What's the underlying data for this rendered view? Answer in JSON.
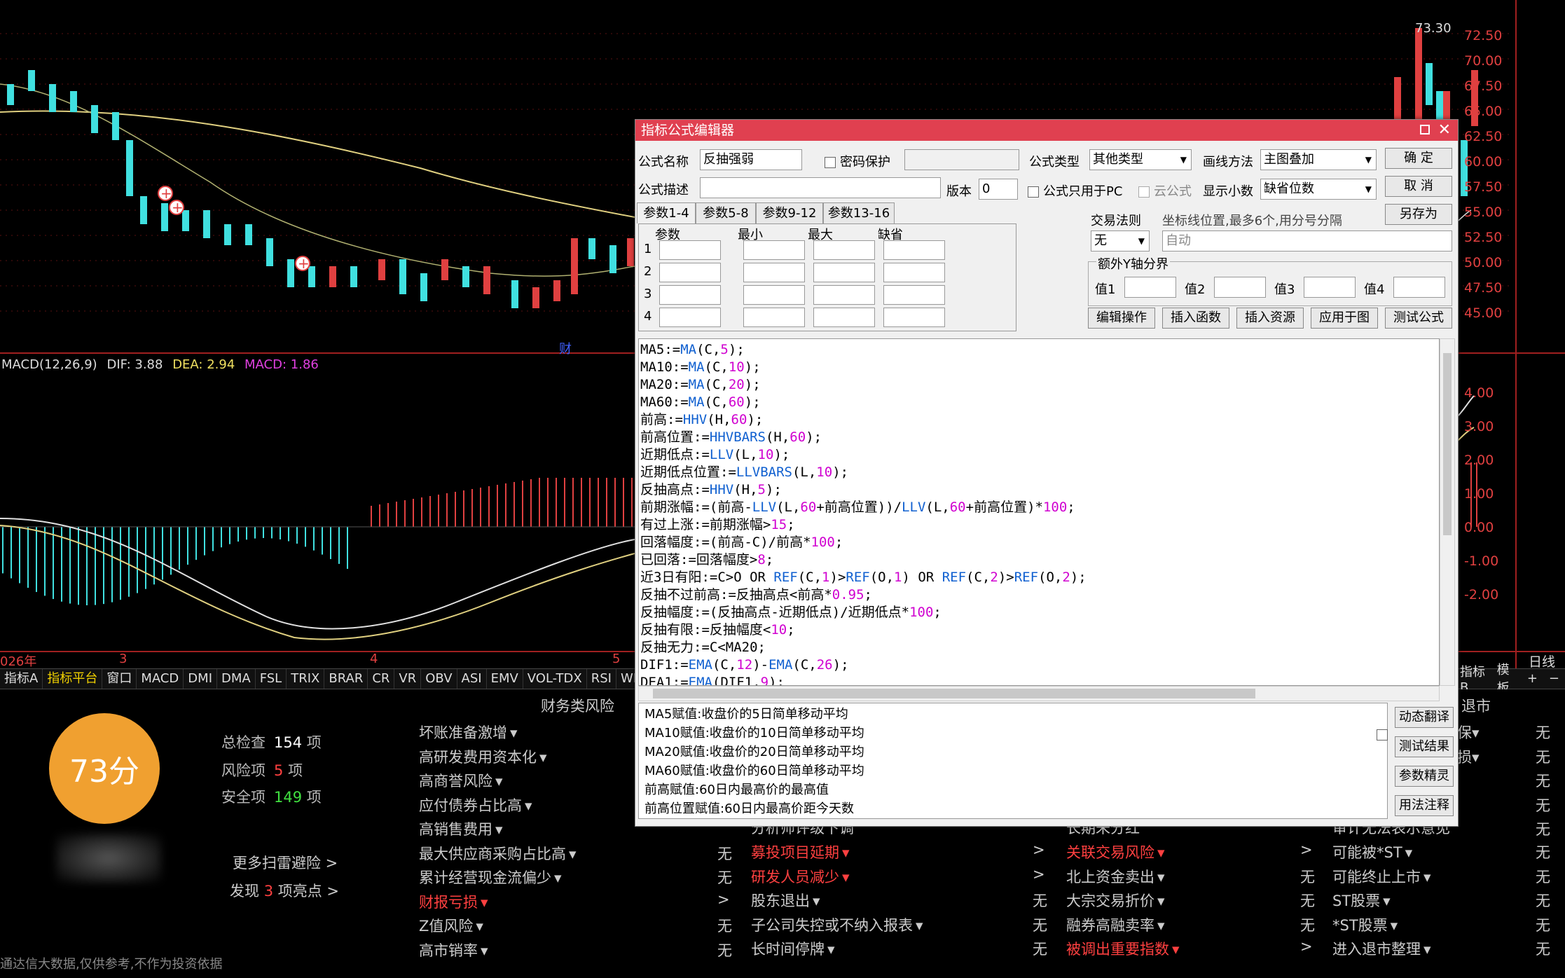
{
  "chart": {
    "price_labels": [
      "72.50",
      "70.00",
      "67.50",
      "65.00",
      "62.50",
      "60.00",
      "57.50",
      "55.00",
      "52.50",
      "50.00",
      "47.50",
      "45.00"
    ],
    "high_label": "73.30",
    "macd_header": "MACD(12,26,9)",
    "dif_text": "DIF: 3.88",
    "dea_text": "DEA: 2.94",
    "macd_text": "MACD: 1.86",
    "macd_labels": [
      "4.00",
      "3.00",
      "2.00",
      "1.00",
      "0.00",
      "-1.00",
      "-2.00"
    ],
    "date_labels": [
      "026年",
      "3",
      "4",
      "5"
    ],
    "fin_marker": "财",
    "period_label": "日线"
  },
  "tabbar": {
    "tabs": [
      "指标A",
      "指标平台",
      "窗口",
      "MACD",
      "DMI",
      "DMA",
      "FSL",
      "TRIX",
      "BRAR",
      "CR",
      "VR",
      "OBV",
      "ASI",
      "EMV",
      "VOL-TDX",
      "RSI",
      "WR"
    ],
    "right_tabs": [
      "指标B",
      "模板",
      "+",
      "−"
    ]
  },
  "risk": {
    "score": "73分",
    "total_label": "总检查",
    "total_value": "154",
    "risk_label": "风险项",
    "risk_value": "5",
    "safe_label": "安全项",
    "safe_value": "149",
    "unit": "项",
    "more_link": "更多扫雷避险 >",
    "found_prefix": "发现",
    "found_value": "3",
    "found_suffix": "项亮点 >",
    "disclaimer": "通达信大数据,仅供参考,不作为投资依据",
    "section_finance": "财务类风险",
    "section_delist": "退市",
    "col1": [
      {
        "label": "坏账准备激增",
        "red": false,
        "val": ""
      },
      {
        "label": "高研发费用资本化",
        "red": false,
        "val": ""
      },
      {
        "label": "高商誉风险",
        "red": false,
        "val": ""
      },
      {
        "label": "应付债券占比高",
        "red": false,
        "val": ""
      },
      {
        "label": "高销售费用",
        "red": false,
        "val": ""
      },
      {
        "label": "最大供应商采购占比高",
        "red": false,
        "val": "无"
      },
      {
        "label": "累计经营现金流偏少",
        "red": false,
        "val": "无"
      },
      {
        "label": "财报亏损",
        "red": true,
        "val": ">"
      },
      {
        "label": "Z值风险",
        "red": false,
        "val": "无"
      },
      {
        "label": "高市销率",
        "red": false,
        "val": "无"
      }
    ],
    "col2": [
      {
        "label": "募投项目延期",
        "red": true,
        "val": ">"
      },
      {
        "label": "研发人员减少",
        "red": true,
        "val": ">"
      },
      {
        "label": "股东退出",
        "red": false,
        "val": "无"
      },
      {
        "label": "子公司失控或不纳入报表",
        "red": false,
        "val": "无"
      },
      {
        "label": "长时间停牌",
        "red": false,
        "val": "无"
      }
    ],
    "col3": [
      {
        "label": "关联交易风险",
        "red": true,
        "val": ">"
      },
      {
        "label": "北上资金卖出",
        "red": false,
        "val": "无"
      },
      {
        "label": "大宗交易折价",
        "red": false,
        "val": "无"
      },
      {
        "label": "融券高融卖率",
        "red": false,
        "val": "无"
      },
      {
        "label": "被调出重要指数",
        "red": true,
        "val": ">"
      }
    ],
    "col4": [
      {
        "label": "可能被*ST",
        "red": false,
        "val": "无"
      },
      {
        "label": "可能终止上市",
        "red": false,
        "val": "无"
      },
      {
        "label": "ST股票",
        "red": false,
        "val": "无"
      },
      {
        "label": "*ST股票",
        "red": false,
        "val": "无"
      },
      {
        "label": "进入退市整理",
        "red": false,
        "val": "无"
      }
    ],
    "col4_top": [
      "保",
      "损"
    ],
    "col4_top_vals": [
      "无",
      "无",
      "无",
      "无",
      "无"
    ],
    "col3_partial": "长期未分红",
    "col2_partial": "分析师评级下调",
    "col4_partial": "审计无法表示意见",
    "col1_partial_val": "无"
  },
  "dialog": {
    "title": "指标公式编辑器",
    "name_label": "公式名称",
    "name_value": "反抽强弱",
    "pwd_label": "密码保护",
    "type_label": "公式类型",
    "type_value": "其他类型",
    "draw_label": "画线方法",
    "draw_value": "主图叠加",
    "ok_button": "确 定",
    "cancel_button": "取 消",
    "saveas_button": "另存为",
    "desc_label": "公式描述",
    "version_label": "版本",
    "version_value": "0",
    "pc_only_label": "公式只用于PC",
    "cloud_label": "云公式",
    "decimal_label": "显示小数",
    "decimal_value": "缺省位数",
    "param_tabs": [
      "参数1-4",
      "参数5-8",
      "参数9-12",
      "参数13-16"
    ],
    "param_headers": [
      "参数",
      "最小",
      "最大",
      "缺省"
    ],
    "param_rows": [
      "1",
      "2",
      "3",
      "4"
    ],
    "trade_rule_label": "交易法则",
    "trade_rule_value": "无",
    "coord_label": "坐标线位置,最多6个,用分号分隔",
    "coord_value": "自动",
    "extra_y_label": "额外Y轴分界",
    "val_labels": [
      "值1",
      "值2",
      "值3",
      "值4"
    ],
    "action_buttons": [
      "编辑操作",
      "插入函数",
      "插入资源",
      "应用于图",
      "测试公式"
    ],
    "code_lines": [
      [
        [
          "t",
          "MA5:="
        ],
        [
          "k",
          "MA"
        ],
        [
          "t",
          "(C,"
        ],
        [
          "n",
          "5"
        ],
        [
          "t",
          ");"
        ]
      ],
      [
        [
          "t",
          "MA10:="
        ],
        [
          "k",
          "MA"
        ],
        [
          "t",
          "(C,"
        ],
        [
          "n",
          "10"
        ],
        [
          "t",
          ");"
        ]
      ],
      [
        [
          "t",
          "MA20:="
        ],
        [
          "k",
          "MA"
        ],
        [
          "t",
          "(C,"
        ],
        [
          "n",
          "20"
        ],
        [
          "t",
          ");"
        ]
      ],
      [
        [
          "t",
          "MA60:="
        ],
        [
          "k",
          "MA"
        ],
        [
          "t",
          "(C,"
        ],
        [
          "n",
          "60"
        ],
        [
          "t",
          ");"
        ]
      ],
      [
        [
          "t",
          "前高:="
        ],
        [
          "k",
          "HHV"
        ],
        [
          "t",
          "(H,"
        ],
        [
          "n",
          "60"
        ],
        [
          "t",
          ");"
        ]
      ],
      [
        [
          "t",
          "前高位置:="
        ],
        [
          "k",
          "HHVBARS"
        ],
        [
          "t",
          "(H,"
        ],
        [
          "n",
          "60"
        ],
        [
          "t",
          ");"
        ]
      ],
      [
        [
          "t",
          "近期低点:="
        ],
        [
          "k",
          "LLV"
        ],
        [
          "t",
          "(L,"
        ],
        [
          "n",
          "10"
        ],
        [
          "t",
          ");"
        ]
      ],
      [
        [
          "t",
          "近期低点位置:="
        ],
        [
          "k",
          "LLVBARS"
        ],
        [
          "t",
          "(L,"
        ],
        [
          "n",
          "10"
        ],
        [
          "t",
          ");"
        ]
      ],
      [
        [
          "t",
          "反抽高点:="
        ],
        [
          "k",
          "HHV"
        ],
        [
          "t",
          "(H,"
        ],
        [
          "n",
          "5"
        ],
        [
          "t",
          ");"
        ]
      ],
      [
        [
          "t",
          "前期涨幅:=(前高-"
        ],
        [
          "k",
          "LLV"
        ],
        [
          "t",
          "(L,"
        ],
        [
          "n",
          "60"
        ],
        [
          "t",
          "+前高位置))/"
        ],
        [
          "k",
          "LLV"
        ],
        [
          "t",
          "(L,"
        ],
        [
          "n",
          "60"
        ],
        [
          "t",
          "+前高位置)*"
        ],
        [
          "n",
          "100"
        ],
        [
          "t",
          ";"
        ]
      ],
      [
        [
          "t",
          "有过上涨:=前期涨幅>"
        ],
        [
          "n",
          "15"
        ],
        [
          "t",
          ";"
        ]
      ],
      [
        [
          "t",
          "回落幅度:=(前高-C)/前高*"
        ],
        [
          "n",
          "100"
        ],
        [
          "t",
          ";"
        ]
      ],
      [
        [
          "t",
          "已回落:=回落幅度>"
        ],
        [
          "n",
          "8"
        ],
        [
          "t",
          ";"
        ]
      ],
      [
        [
          "t",
          "近3日有阳:=C>O OR "
        ],
        [
          "k",
          "REF"
        ],
        [
          "t",
          "(C,"
        ],
        [
          "n",
          "1"
        ],
        [
          "t",
          ")>"
        ],
        [
          "k",
          "REF"
        ],
        [
          "t",
          "(O,"
        ],
        [
          "n",
          "1"
        ],
        [
          "t",
          ") OR "
        ],
        [
          "k",
          "REF"
        ],
        [
          "t",
          "(C,"
        ],
        [
          "n",
          "2"
        ],
        [
          "t",
          ")>"
        ],
        [
          "k",
          "REF"
        ],
        [
          "t",
          "(O,"
        ],
        [
          "n",
          "2"
        ],
        [
          "t",
          ");"
        ]
      ],
      [
        [
          "t",
          "反抽不过前高:=反抽高点<前高*"
        ],
        [
          "n",
          "0.95"
        ],
        [
          "t",
          ";"
        ]
      ],
      [
        [
          "t",
          "反抽幅度:=(反抽高点-近期低点)/近期低点*"
        ],
        [
          "n",
          "100"
        ],
        [
          "t",
          ";"
        ]
      ],
      [
        [
          "t",
          "反抽有限:=反抽幅度<"
        ],
        [
          "n",
          "10"
        ],
        [
          "t",
          ";"
        ]
      ],
      [
        [
          "t",
          "反抽无力:=C<MA20;"
        ]
      ],
      [
        [
          "t",
          "DIF1:="
        ],
        [
          "k",
          "EMA"
        ],
        [
          "t",
          "(C,"
        ],
        [
          "n",
          "12"
        ],
        [
          "t",
          ")-"
        ],
        [
          "k",
          "EMA"
        ],
        [
          "t",
          "(C,"
        ],
        [
          "n",
          "26"
        ],
        [
          "t",
          ");"
        ]
      ],
      [
        [
          "t",
          "DEA1:="
        ],
        [
          "k",
          "EMA"
        ],
        [
          "t",
          "(DIF1,"
        ],
        [
          "n",
          "9"
        ],
        [
          "t",
          ");"
        ]
      ]
    ],
    "notes": [
      "MA5赋值:收盘价的5日简单移动平均",
      "MA10赋值:收盘价的10日简单移动平均",
      "MA20赋值:收盘价的20日简单移动平均",
      "MA60赋值:收盘价的60日简单移动平均",
      "前高赋值:60日内最高价的最高值",
      "前高位置赋值:60日内最高价距今天数"
    ],
    "side_buttons": [
      "动态翻译",
      "测试结果",
      "参数精灵",
      "用法注释"
    ]
  }
}
